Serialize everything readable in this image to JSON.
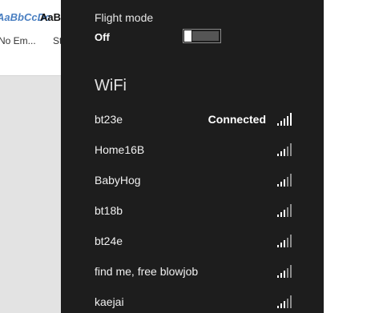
{
  "background_app": {
    "style_previews": [
      "AaBbCcDc",
      "AaB"
    ],
    "style_names": [
      "No Em...",
      "St"
    ]
  },
  "flight_mode": {
    "label": "Flight mode",
    "state": "Off",
    "enabled": false
  },
  "wifi": {
    "title": "WiFi",
    "networks": [
      {
        "name": "bt23e",
        "status": "Connected",
        "signal": "full"
      },
      {
        "name": "Home16B",
        "status": "",
        "signal": "weak"
      },
      {
        "name": "BabyHog",
        "status": "",
        "signal": "weak"
      },
      {
        "name": "bt18b",
        "status": "",
        "signal": "weak"
      },
      {
        "name": "bt24e",
        "status": "",
        "signal": "weak"
      },
      {
        "name": "find me, free blowjob",
        "status": "",
        "signal": "weak"
      },
      {
        "name": "kaejai",
        "status": "",
        "signal": "weak"
      }
    ]
  },
  "colors": {
    "panel_bg": "#1d1d1d",
    "text": "#ffffff",
    "word_style_accent": "#4a7fc1"
  },
  "icons": {
    "signal": "wifi-signal-icon"
  }
}
